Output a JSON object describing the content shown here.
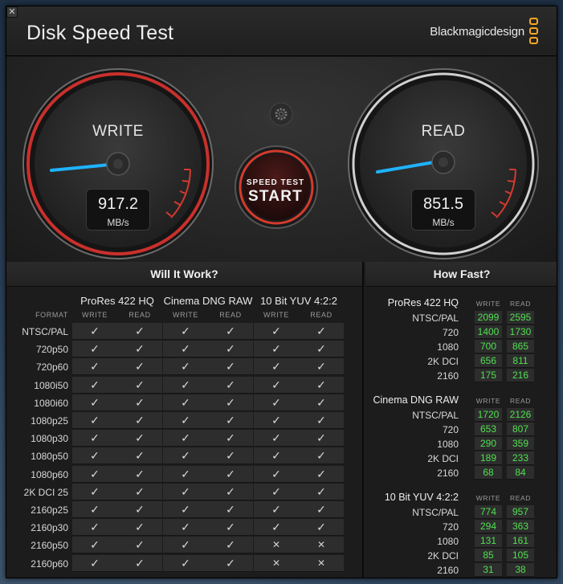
{
  "window": {
    "title": "Disk Speed Test",
    "brand": "Blackmagicdesign",
    "close_glyph": "✕"
  },
  "gauges": {
    "write": {
      "label": "WRITE",
      "value": "917.2",
      "unit": "MB/s"
    },
    "read": {
      "label": "READ",
      "value": "851.5",
      "unit": "MB/s"
    },
    "start_button": {
      "line1": "SPEED TEST",
      "line2": "START"
    },
    "settings_icon": "gear-icon"
  },
  "colors": {
    "needle": "#1fb3ff",
    "write_ring": "#c9302c",
    "read_ring": "#d8d8d8",
    "speed_value": "#4fe14f",
    "brand_logo": "#f5a623"
  },
  "will_it_work": {
    "title": "Will It Work?",
    "format_label": "FORMAT",
    "groups": [
      {
        "name": "ProRes 422 HQ",
        "write": "WRITE",
        "read": "READ"
      },
      {
        "name": "Cinema DNG RAW",
        "write": "WRITE",
        "read": "READ"
      },
      {
        "name": "10 Bit YUV 4:2:2",
        "write": "WRITE",
        "read": "READ"
      }
    ],
    "rows": [
      {
        "format": "NTSC/PAL",
        "cells": [
          "✓",
          "✓",
          "✓",
          "✓",
          "✓",
          "✓"
        ]
      },
      {
        "format": "720p50",
        "cells": [
          "✓",
          "✓",
          "✓",
          "✓",
          "✓",
          "✓"
        ]
      },
      {
        "format": "720p60",
        "cells": [
          "✓",
          "✓",
          "✓",
          "✓",
          "✓",
          "✓"
        ]
      },
      {
        "format": "1080i50",
        "cells": [
          "✓",
          "✓",
          "✓",
          "✓",
          "✓",
          "✓"
        ]
      },
      {
        "format": "1080i60",
        "cells": [
          "✓",
          "✓",
          "✓",
          "✓",
          "✓",
          "✓"
        ]
      },
      {
        "format": "1080p25",
        "cells": [
          "✓",
          "✓",
          "✓",
          "✓",
          "✓",
          "✓"
        ]
      },
      {
        "format": "1080p30",
        "cells": [
          "✓",
          "✓",
          "✓",
          "✓",
          "✓",
          "✓"
        ]
      },
      {
        "format": "1080p50",
        "cells": [
          "✓",
          "✓",
          "✓",
          "✓",
          "✓",
          "✓"
        ]
      },
      {
        "format": "1080p60",
        "cells": [
          "✓",
          "✓",
          "✓",
          "✓",
          "✓",
          "✓"
        ]
      },
      {
        "format": "2K DCI 25",
        "cells": [
          "✓",
          "✓",
          "✓",
          "✓",
          "✓",
          "✓"
        ]
      },
      {
        "format": "2160p25",
        "cells": [
          "✓",
          "✓",
          "✓",
          "✓",
          "✓",
          "✓"
        ]
      },
      {
        "format": "2160p30",
        "cells": [
          "✓",
          "✓",
          "✓",
          "✓",
          "✓",
          "✓"
        ]
      },
      {
        "format": "2160p50",
        "cells": [
          "✓",
          "✓",
          "✓",
          "✓",
          "✕",
          "✕"
        ]
      },
      {
        "format": "2160p60",
        "cells": [
          "✓",
          "✓",
          "✓",
          "✓",
          "✕",
          "✕"
        ]
      }
    ]
  },
  "how_fast": {
    "title": "How Fast?",
    "write_label": "WRITE",
    "read_label": "READ",
    "groups": [
      {
        "name": "ProRes 422 HQ",
        "rows": [
          {
            "format": "NTSC/PAL",
            "write": "2099",
            "read": "2595"
          },
          {
            "format": "720",
            "write": "1400",
            "read": "1730"
          },
          {
            "format": "1080",
            "write": "700",
            "read": "865"
          },
          {
            "format": "2K DCI",
            "write": "656",
            "read": "811"
          },
          {
            "format": "2160",
            "write": "175",
            "read": "216"
          }
        ]
      },
      {
        "name": "Cinema DNG RAW",
        "rows": [
          {
            "format": "NTSC/PAL",
            "write": "1720",
            "read": "2126"
          },
          {
            "format": "720",
            "write": "653",
            "read": "807"
          },
          {
            "format": "1080",
            "write": "290",
            "read": "359"
          },
          {
            "format": "2K DCI",
            "write": "189",
            "read": "233"
          },
          {
            "format": "2160",
            "write": "68",
            "read": "84"
          }
        ]
      },
      {
        "name": "10 Bit YUV 4:2:2",
        "rows": [
          {
            "format": "NTSC/PAL",
            "write": "774",
            "read": "957"
          },
          {
            "format": "720",
            "write": "294",
            "read": "363"
          },
          {
            "format": "1080",
            "write": "131",
            "read": "161"
          },
          {
            "format": "2K DCI",
            "write": "85",
            "read": "105"
          },
          {
            "format": "2160",
            "write": "31",
            "read": "38"
          }
        ]
      }
    ]
  }
}
